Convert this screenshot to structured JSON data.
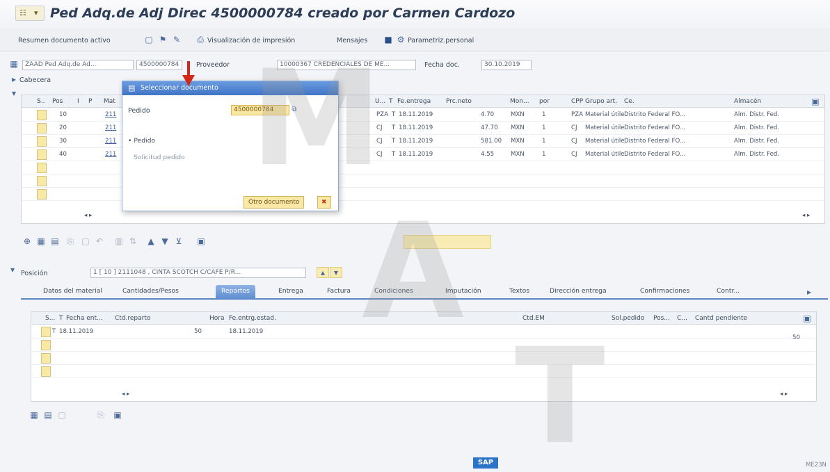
{
  "title": "Ped Adq.de Adj Direc 4500000784 creado por Carmen Cardozo",
  "toolbar": {
    "summary": "Resumen documento activo",
    "print_preview": "Visualización de impresión",
    "messages": "Mensajes",
    "personal": "Parametriz.personal"
  },
  "header": {
    "doc_type": "ZAAD Ped Adq.de Ad...",
    "doc_number": "4500000784",
    "supplier_label": "Proveedor",
    "supplier_value": "10000367 CREDENCIALES DE ME...",
    "date_label": "Fecha doc.",
    "date_value": "30.10.2019",
    "header_section": "Cabecera"
  },
  "items_grid": {
    "columns": [
      "S..",
      "Pos",
      "I",
      "P",
      "Mat",
      "U...",
      "T",
      "Fe.entrega",
      "Prc.neto",
      "Mon...",
      "por",
      "CPP",
      "Grupo art.",
      "Ce.",
      "Almacén"
    ],
    "rows": [
      {
        "pos": "10",
        "mat": "211",
        "um": "PZA",
        "t": "T",
        "date": "18.11.2019",
        "price": "4.70",
        "cur": "MXN",
        "per": "1",
        "cpp": "PZA",
        "group": "Material útile",
        "plant": "Distrito Federal FO...",
        "store": "Alm. Distr. Fed."
      },
      {
        "pos": "20",
        "mat": "211",
        "um": "CJ",
        "t": "T",
        "date": "18.11.2019",
        "price": "47.70",
        "cur": "MXN",
        "per": "1",
        "cpp": "CJ",
        "group": "Material útile",
        "plant": "Distrito Federal FO...",
        "store": "Alm. Distr. Fed."
      },
      {
        "pos": "30",
        "mat": "211",
        "um": "CJ",
        "t": "T",
        "date": "18.11.2019",
        "price": "581.00",
        "cur": "MXN",
        "per": "1",
        "cpp": "CJ",
        "group": "Material útile",
        "plant": "Distrito Federal FO...",
        "store": "Alm. Distr. Fed."
      },
      {
        "pos": "40",
        "mat": "211",
        "um": "CJ",
        "t": "T",
        "date": "18.11.2019",
        "price": "4.55",
        "cur": "MXN",
        "per": "1",
        "cpp": "CJ",
        "group": "Material útile",
        "plant": "Distrito Federal FO...",
        "store": "Alm. Distr. Fed."
      }
    ]
  },
  "position": {
    "label": "Posición",
    "value": "1 [ 10 ] 2111048 , CINTA SCOTCH C/CAFE P/R..."
  },
  "tabs": [
    "Datos del material",
    "Cantidades/Pesos",
    "Repartos",
    "Entrega",
    "Factura",
    "Condiciones",
    "Imputación",
    "Textos",
    "Dirección entrega",
    "Confirmaciones",
    "Contr..."
  ],
  "active_tab": "Repartos",
  "schedule_grid": {
    "columns": [
      "S...",
      "T",
      "Fecha ent...",
      "Ctd.reparto",
      "Hora",
      "Fe.entrg.estad.",
      "Ctd.EM",
      "Sol.pedido",
      "Pos...",
      "C...",
      "Cantd pendiente"
    ],
    "rows": [
      {
        "t": "T",
        "date": "18.11.2019",
        "qty": "50",
        "stat_date": "18.11.2019",
        "pending": "50"
      }
    ]
  },
  "dialog": {
    "title": "Seleccionar documento",
    "order_label": "Pedido",
    "order_value": "4500000784",
    "radio_order": "Pedido",
    "radio_request": "Solicitud pedido",
    "other_doc": "Otro documento"
  },
  "watermark": [
    "M",
    "A",
    "T"
  ],
  "footer": {
    "sap": "SAP",
    "tcode": "ME23N"
  }
}
